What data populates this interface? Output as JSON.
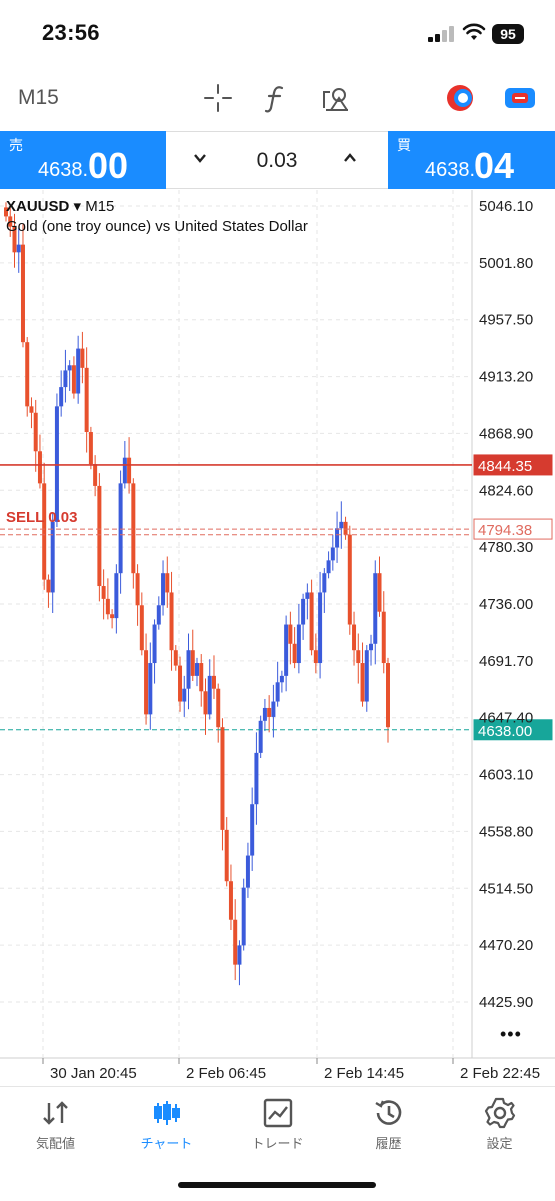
{
  "status_bar": {
    "time": "23:56",
    "battery": "95"
  },
  "toolbar": {
    "timeframe": "M15",
    "icons": [
      "crosshair-icon",
      "indicator-f-icon",
      "objects-icon",
      "one-click-trading-icon",
      "trade-toggle-icon"
    ]
  },
  "trade_panel": {
    "sell_label": "売",
    "sell_price_small": "4638.",
    "sell_price_big": "00",
    "lot": "0.03",
    "buy_label": "買",
    "buy_price_small": "4638.",
    "buy_price_big": "04"
  },
  "chart": {
    "symbol": "XAUUSD",
    "timeframe_label": "▾ M15",
    "description": "Gold (one troy ounce) vs United States Dollar",
    "price_axis": [
      "5046.10",
      "5001.80",
      "4957.50",
      "4913.20",
      "4868.90",
      "4824.60",
      "4780.30",
      "4736.00",
      "4691.70",
      "4647.40",
      "4603.10",
      "4558.80",
      "4514.50",
      "4470.20",
      "4425.90"
    ],
    "time_axis": [
      "30 Jan 20:45",
      "2 Feb 06:45",
      "2 Feb 14:45",
      "2 Feb 22:45"
    ],
    "lines": {
      "alert_price": "4844.35",
      "order_price": "4794.38",
      "order_label": "SELL 0.03",
      "bid_price": "4638.00"
    },
    "colors": {
      "bull": "#3b5bdb",
      "bear": "#e8512d",
      "order_line": "#d63b2f",
      "bid_line": "#17a69a",
      "accent": "#1a8cff"
    },
    "more_label": "•••"
  },
  "nav": [
    {
      "label": "気配値",
      "icon": "quotes-icon"
    },
    {
      "label": "チャート",
      "icon": "chart-icon"
    },
    {
      "label": "トレード",
      "icon": "trade-icon"
    },
    {
      "label": "履歴",
      "icon": "history-icon"
    },
    {
      "label": "設定",
      "icon": "settings-icon"
    }
  ]
}
